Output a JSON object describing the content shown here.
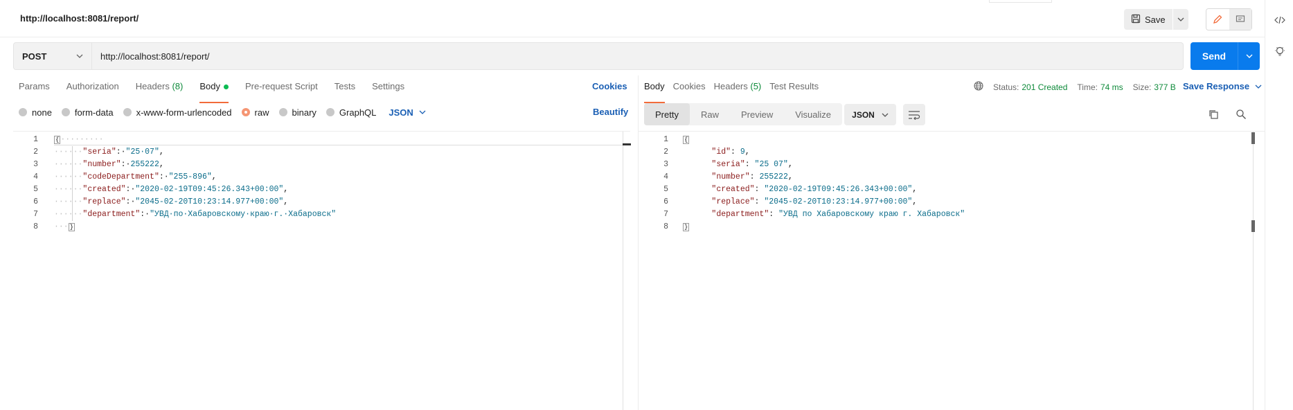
{
  "header": {
    "title": "http://localhost:8081/report/",
    "save_label": "Save"
  },
  "request": {
    "method": "POST",
    "url": "http://localhost:8081/report/",
    "send_label": "Send",
    "tabs": [
      {
        "label": "Params"
      },
      {
        "label": "Authorization"
      },
      {
        "label": "Headers",
        "count": "(8)"
      },
      {
        "label": "Body"
      },
      {
        "label": "Pre-request Script"
      },
      {
        "label": "Tests"
      },
      {
        "label": "Settings"
      }
    ],
    "cookies_label": "Cookies",
    "body_types": [
      "none",
      "form-data",
      "x-www-form-urlencoded",
      "raw",
      "binary",
      "GraphQL"
    ],
    "body_format": "JSON",
    "beautify_label": "Beautify",
    "line_numbers": [
      "1",
      "2",
      "3",
      "4",
      "5",
      "6",
      "7",
      "8"
    ],
    "body_lines": [
      {
        "key": "\"seria\"",
        "val": "\"25·07\""
      },
      {
        "key": "\"number\"",
        "val": "255222"
      },
      {
        "key": "\"codeDepartment\"",
        "val": "\"255-896\""
      },
      {
        "key": "\"created\"",
        "val": "\"2020-02-19T09:45:26.343+00:00\""
      },
      {
        "key": "\"replace\"",
        "val": "\"2045-02-20T10:23:14.977+00:00\""
      },
      {
        "key": "\"department\"",
        "val": "\"УВД·по·Хабаровскому·краю·г.·Хабаровск\""
      }
    ]
  },
  "response": {
    "tabs": [
      {
        "label": "Body"
      },
      {
        "label": "Cookies"
      },
      {
        "label": "Headers",
        "count": "(5)"
      },
      {
        "label": "Test Results"
      }
    ],
    "status_label": "Status:",
    "status_value": "201 Created",
    "time_label": "Time:",
    "time_value": "74 ms",
    "size_label": "Size:",
    "size_value": "377 B",
    "save_response_label": "Save Response",
    "view_tabs": [
      "Pretty",
      "Raw",
      "Preview",
      "Visualize"
    ],
    "format": "JSON",
    "line_numbers": [
      "1",
      "2",
      "3",
      "4",
      "5",
      "6",
      "7",
      "8"
    ],
    "body_lines": [
      {
        "key": "\"id\"",
        "val": "9"
      },
      {
        "key": "\"seria\"",
        "val": "\"25 07\""
      },
      {
        "key": "\"number\"",
        "val": "255222"
      },
      {
        "key": "\"created\"",
        "val": "\"2020-02-19T09:45:26.343+00:00\""
      },
      {
        "key": "\"replace\"",
        "val": "\"2045-02-20T10:23:14.977+00:00\""
      },
      {
        "key": "\"department\"",
        "val": "\"УВД по Хабаровскому краю г. Хабаровск\""
      }
    ]
  },
  "colors": {
    "accent": "#f26b3a",
    "send": "#097bed",
    "link": "#1a5fb4",
    "success": "#0e8a3a"
  }
}
